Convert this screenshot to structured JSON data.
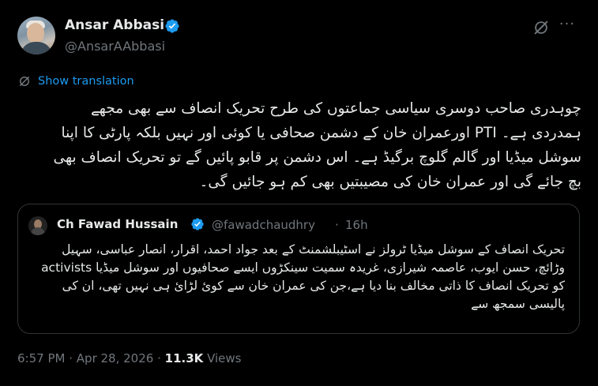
{
  "author": {
    "name": "Ansar Abbasi",
    "handle": "@AnsarAAbbasi",
    "verified": true
  },
  "translate_label": "Show translation",
  "tweet_text": "چوہدری صاحب دوسری سیاسی جماعتوں کی طرح تحریک انصاف سے بھی مجھے ہمدردی ہے۔ PTI اورعمران خان کے دشمن صحافی یا کوئی اور نہیں بلکہ پارٹی کا اپنا سوشل میڈیا اور گالم گلوچ برگیڈ ہے۔ اس دشمن پر قابو پائیں گے تو تحریک انصاف بھی بچ جائے گی اور عمران خان کی مصیبتیں بھی کم ہو جائیں گی۔",
  "quoted": {
    "name": "Ch Fawad Hussain",
    "handle": "@fawadchaudhry",
    "separator": "·",
    "time": "16h",
    "verified": true,
    "text": "تحریک انصاف کے سوشل میڈیا ٹرولز نے اسٹیبلشمنٹ کے بعد جواد احمد، اقرار، انصار عباسی، سہیل وڑائچ، حسن ایوب، عاصمہ شیرازی، غریدہ سمیت سینکڑوں ایسے صحافیوں اور سوشل میڈیا activists کو تحریک انصاف کا ذاتی مخالف بنا دیا ہے،جن کی عمران خان سے کوئ لڑائ ہی نہیں تھی، ان کی پالیسی سمجھ سے"
  },
  "meta": {
    "time": "6:57 PM",
    "sep1": "·",
    "date": "Apr 28, 2026",
    "sep2": "·",
    "views_count": "11.3K",
    "views_label": "Views"
  },
  "colors": {
    "background": "#000000",
    "text": "#e7e9ea",
    "secondary": "#71767b",
    "accent": "#1d9bf0",
    "border": "#2f3336"
  },
  "icons": {
    "verified": "verified-badge-icon",
    "grok": "grok-icon",
    "more": "more-icon",
    "translate": "translate-icon"
  }
}
